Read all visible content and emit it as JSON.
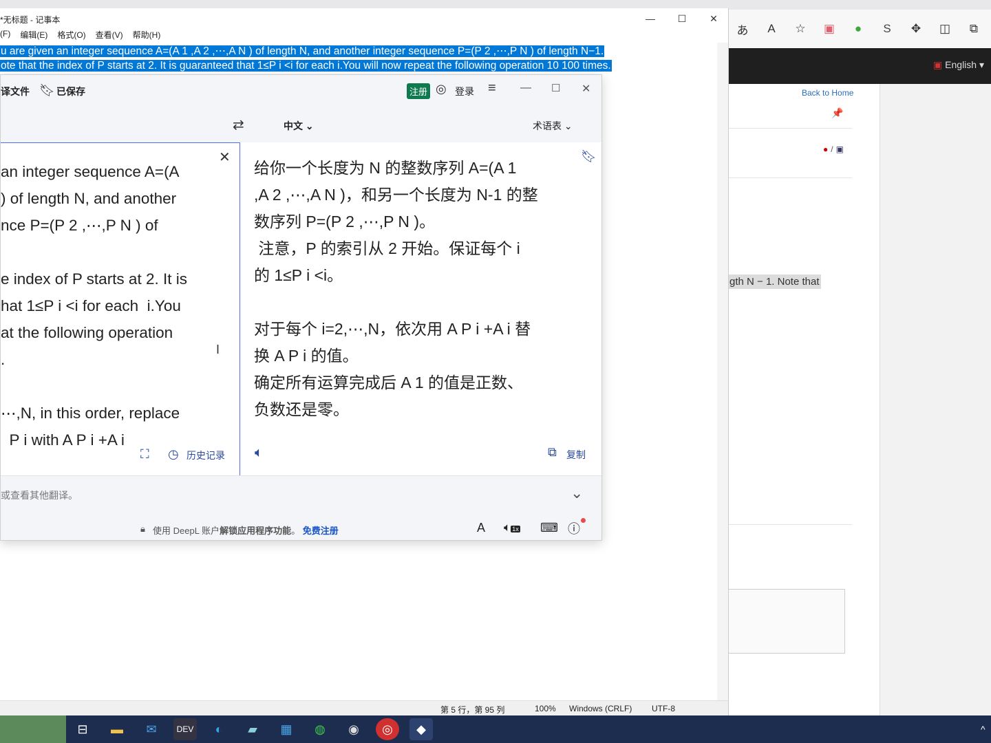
{
  "browser": {
    "nav_language": "English",
    "back_home": "Back to Home",
    "lang_switch": "/",
    "statement_fragment": "gth N − 1. Note that"
  },
  "notepad": {
    "title": "*无标题 - 记事本",
    "menu": [
      "(F)",
      "编辑(E)",
      "格式(O)",
      "查看(V)",
      "帮助(H)"
    ],
    "line1": "u are given an integer sequence A=(A 1 ,A 2 ,⋯,A N ) of length N, and another integer sequence P=(P 2 ,⋯,P N ) of length N−1.",
    "line2": "ote that the index of P starts at 2. It is guaranteed that 1≤P i <i for each i.You will now repeat the following operation 10 100  times.",
    "status_pos": "第 5 行，第 95 列",
    "status_zoom": "100%",
    "status_eol": "Windows (CRLF)",
    "status_enc": "UTF-8"
  },
  "deepl": {
    "file_label": "译文件",
    "saved_label": "已保存",
    "register_label": "注册",
    "login_label": "登录",
    "target_language": "中文",
    "glossary_label": "术语表",
    "source_text": "an integer sequence A=(A\n) of length N, and another\nnce P=(P 2 ,⋯,P N ) of\n\ne index of P starts at 2. It is\nhat 1≤P i <i for each  i.You\nat the following operation\n.\n\n⋯,N, in this order, replace\n  P i with A P i +A i",
    "target_text": "给你一个长度为 N 的整数序列 A=(A 1\n,A 2 ,⋯,A N )，和另一个长度为 N-1 的整\n数序列 P=(P 2 ,⋯,P N )。\n 注意，P 的索引从 2 开始。保证每个 i\n的 1≤P i <i。\n\n对于每个 i=2,⋯,N，依次用 A P i +A i 替\n换 A P i 的值。\n确定所有运算完成后 A 1 的值是正数、\n负数还是零。",
    "history_label": "历史记录",
    "copy_label": "复制",
    "alternatives_label": "或查看其他翻译。",
    "footer_notice_prefix": "使用 DeepL 账户",
    "footer_notice_bold": "解锁应用程序功能",
    "footer_notice_suffix": "。",
    "footer_register": "免费注册",
    "speed_label": "1x"
  },
  "taskbar": {
    "apps": [
      "task-view",
      "file-explorer",
      "mail",
      "dev-tools",
      "edge",
      "notes",
      "store",
      "wechat",
      "obs",
      "netease-music",
      "deepl"
    ]
  }
}
